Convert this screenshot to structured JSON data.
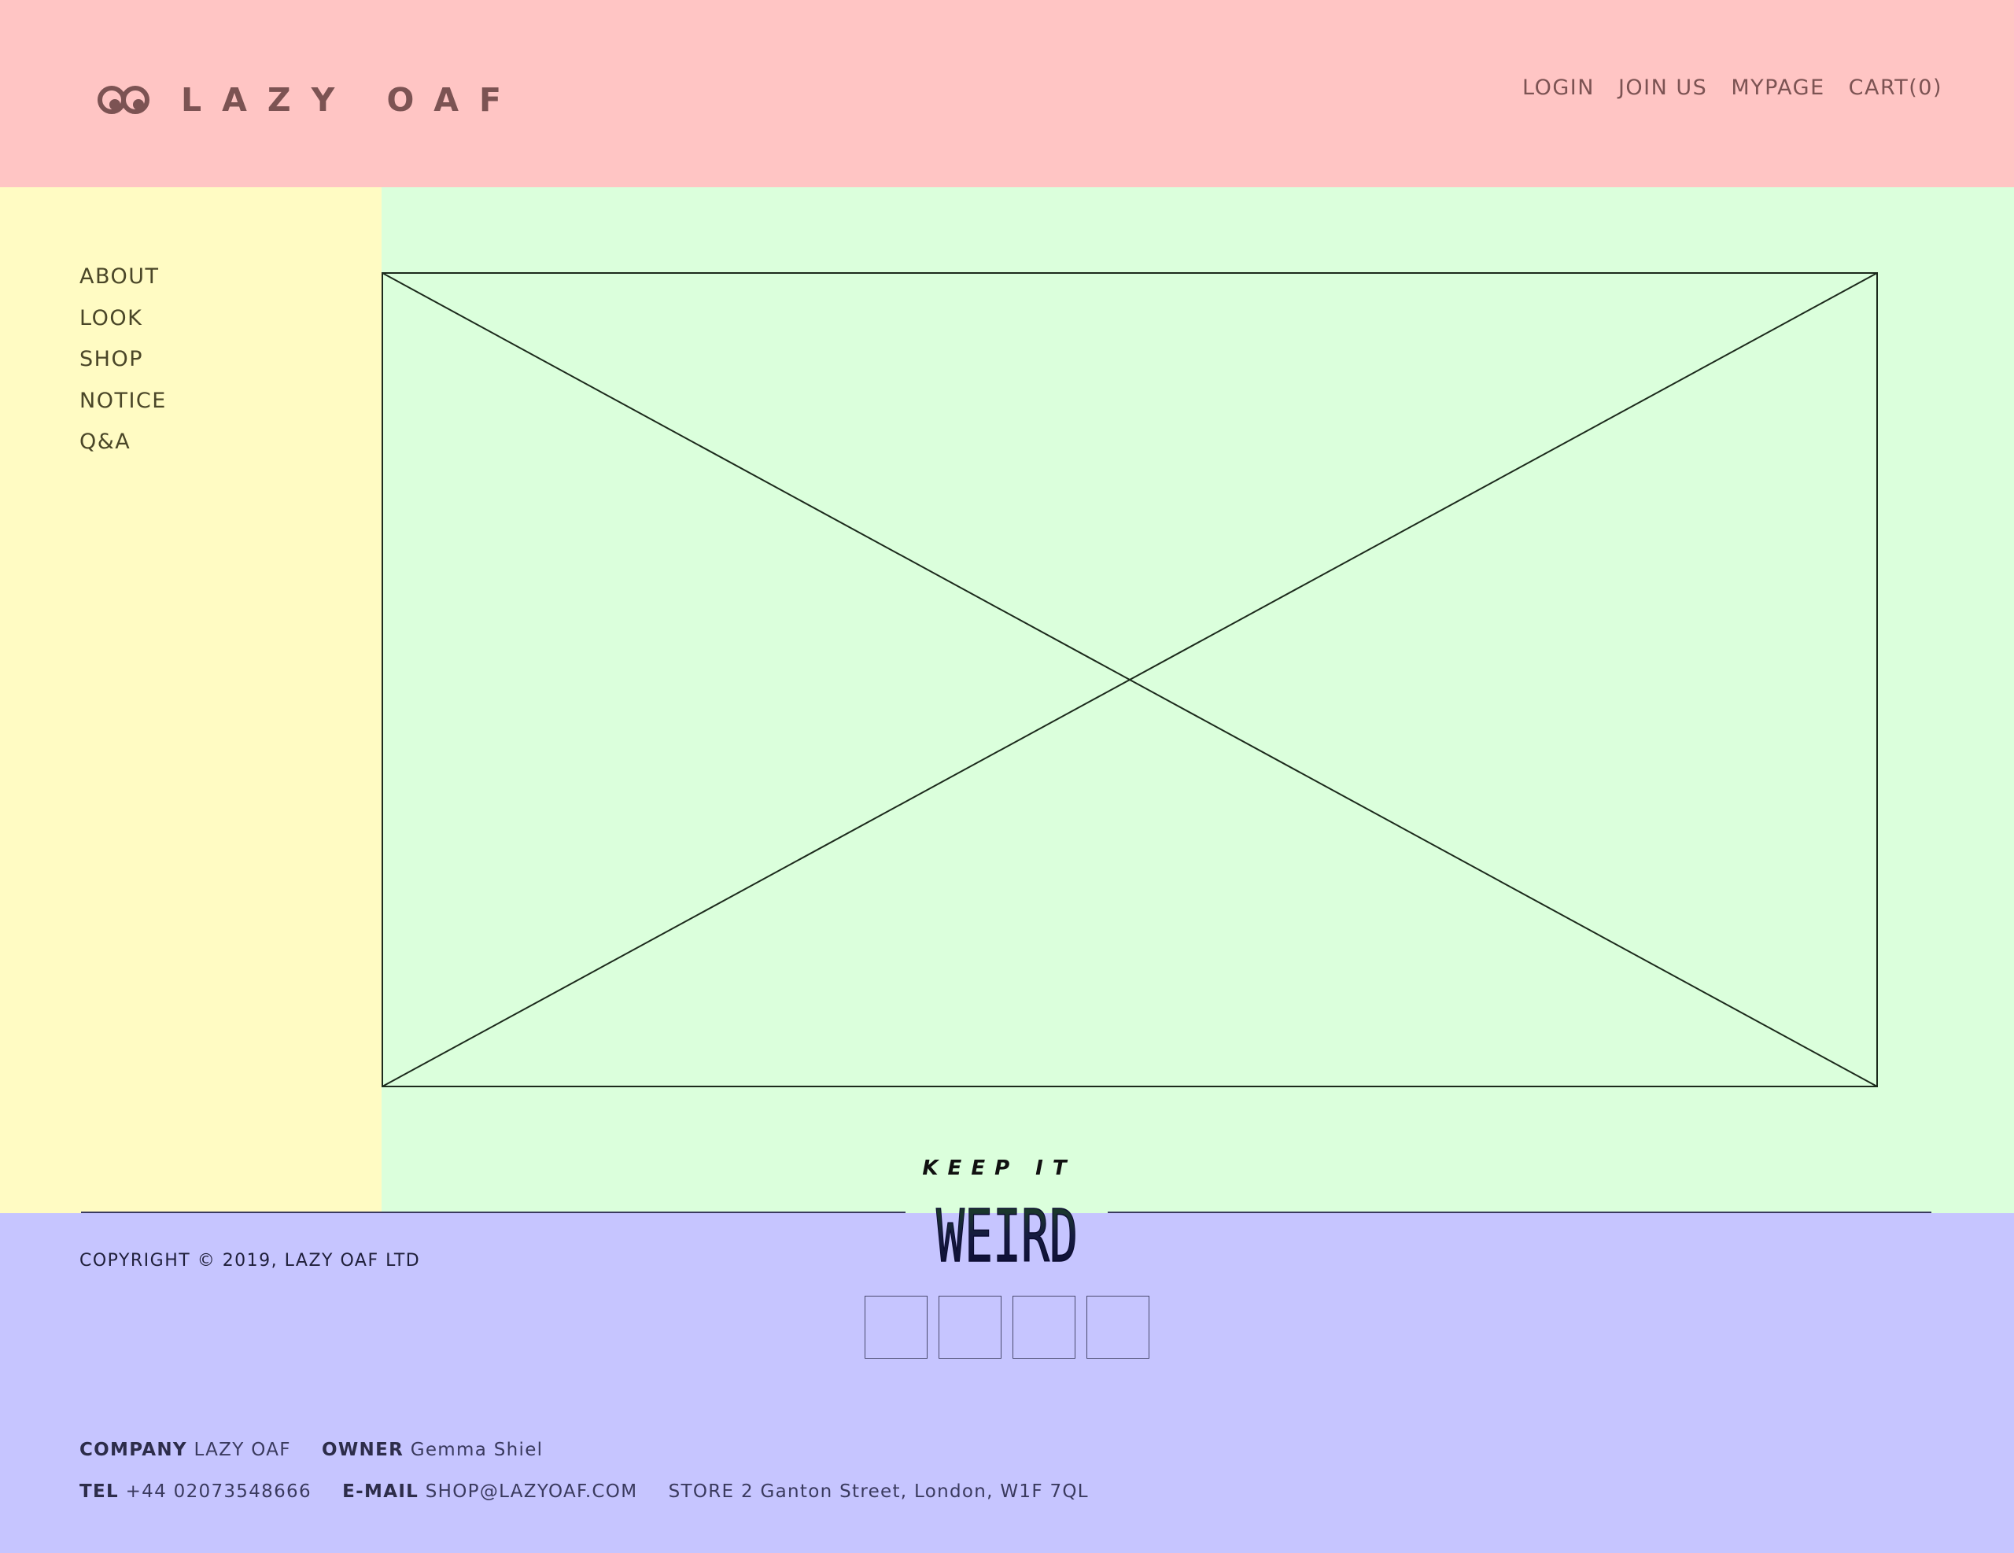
{
  "header": {
    "logo_text": "LAZY OAF",
    "nav": [
      "LOGIN",
      "JOIN US",
      "MYPAGE",
      "CART(0)"
    ]
  },
  "sidebar": {
    "items": [
      "ABOUT",
      "LOOK",
      "SHOP",
      "NOTICE",
      "Q&A"
    ]
  },
  "badge": {
    "top": "KEEP IT",
    "bottom": "WEIRD"
  },
  "footer": {
    "copyright": "COPYRIGHT © 2019, LAZY OAF LTD",
    "company_label": "COMPANY",
    "company_value": "LAZY OAF",
    "owner_label": "OWNER",
    "owner_value": "Gemma Shiel",
    "tel_label": "TEL",
    "tel_value": "+44 02073548666",
    "email_label": "E-MAIL",
    "email_value": "SHOP@LAZYOAF.COM",
    "store_label": "STORE",
    "store_value": "2 Ganton Street, London, W1F 7QL"
  },
  "colors": {
    "header_bg": "#ffc5c4",
    "sidebar_bg": "#fffbc3",
    "main_bg": "#dbffdc",
    "footer_bg": "#c6c5ff",
    "brand_text": "#7c5353"
  }
}
